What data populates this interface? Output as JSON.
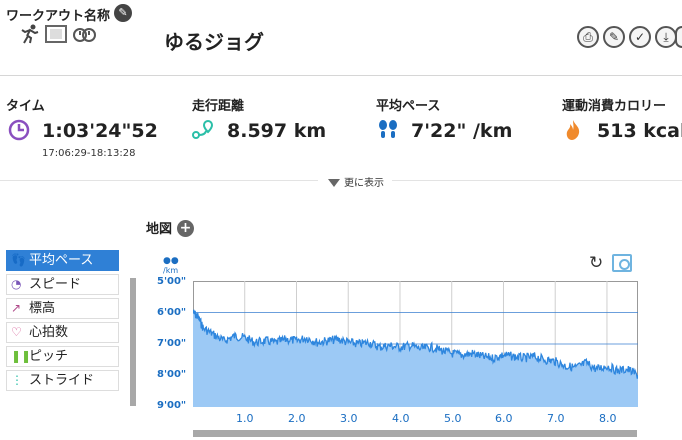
{
  "workout": {
    "name_label": "ワークアウト名称",
    "title": "ゆるジョグ"
  },
  "stats": {
    "time": {
      "label": "タイム",
      "value": "1:03'24\"52",
      "range": "17:06:29-18:13:28"
    },
    "distance": {
      "label": "走行距離",
      "value": "8.597 km"
    },
    "pace": {
      "label": "平均ペース",
      "value": "7'22\" /km"
    },
    "calories": {
      "label": "運動消費カロリー",
      "value": "513 kcal"
    }
  },
  "more_label": "更に表示",
  "map_label": "地図",
  "metrics": [
    {
      "label": "平均ペース",
      "icon": "footsteps-icon",
      "active": true
    },
    {
      "label": "スピード",
      "icon": "speedometer-icon",
      "active": false
    },
    {
      "label": "標高",
      "icon": "elevation-icon",
      "active": false
    },
    {
      "label": "心拍数",
      "icon": "heart-icon",
      "active": false
    },
    {
      "label": "ピッチ",
      "icon": "pitch-icon",
      "active": false
    },
    {
      "label": "ストライド",
      "icon": "stride-icon",
      "active": false
    }
  ],
  "colors": {
    "accent": "#2f80d6",
    "chart_line": "#2e86de",
    "chart_fill": "#9cc9f5",
    "axis_text": "#1b6ec2",
    "calorie_icon": "#f08a2c",
    "time_icon": "#8a4fbf",
    "pitch_icon": "#6dbf3b",
    "stride_icon": "#2bbfa8",
    "heart_icon": "#d04a8a"
  },
  "chart_data": {
    "type": "area",
    "y_unit": "/km",
    "y_ticks": [
      "5'00\"",
      "6'00\"",
      "7'00\"",
      "8'00\"",
      "9'00\""
    ],
    "x_ticks": [
      "1.0",
      "2.0",
      "3.0",
      "4.0",
      "5.0",
      "6.0",
      "7.0",
      "8.0"
    ],
    "ylim_min_per_km": [
      5,
      9
    ],
    "xlim_km": [
      0,
      8.6
    ],
    "inverted_y": true,
    "grid": true,
    "series": [
      {
        "x": [
          0,
          0.1,
          0.2,
          0.4,
          0.6,
          0.8,
          1.0,
          1.2,
          1.4,
          1.6,
          1.8,
          2.0,
          2.2,
          2.4,
          2.6,
          2.8,
          3.0,
          3.2,
          3.4,
          3.6,
          3.8,
          4.0,
          4.2,
          4.4,
          4.6,
          4.8,
          5.0,
          5.2,
          5.4,
          5.6,
          5.8,
          6.0,
          6.2,
          6.4,
          6.6,
          6.8,
          7.0,
          7.2,
          7.4,
          7.6,
          7.8,
          8.0,
          8.2,
          8.4,
          8.6
        ],
        "values": [
          6.0,
          6.15,
          6.5,
          6.7,
          6.9,
          6.75,
          6.8,
          6.95,
          6.9,
          6.95,
          6.85,
          6.9,
          6.8,
          6.95,
          6.9,
          6.85,
          6.95,
          7.0,
          6.95,
          7.1,
          7.05,
          7.1,
          7.05,
          7.15,
          7.1,
          7.2,
          7.3,
          7.35,
          7.3,
          7.4,
          7.45,
          7.35,
          7.4,
          7.45,
          7.4,
          7.5,
          7.55,
          7.7,
          7.75,
          7.6,
          7.8,
          7.7,
          7.85,
          7.8,
          8.0
        ]
      }
    ]
  }
}
